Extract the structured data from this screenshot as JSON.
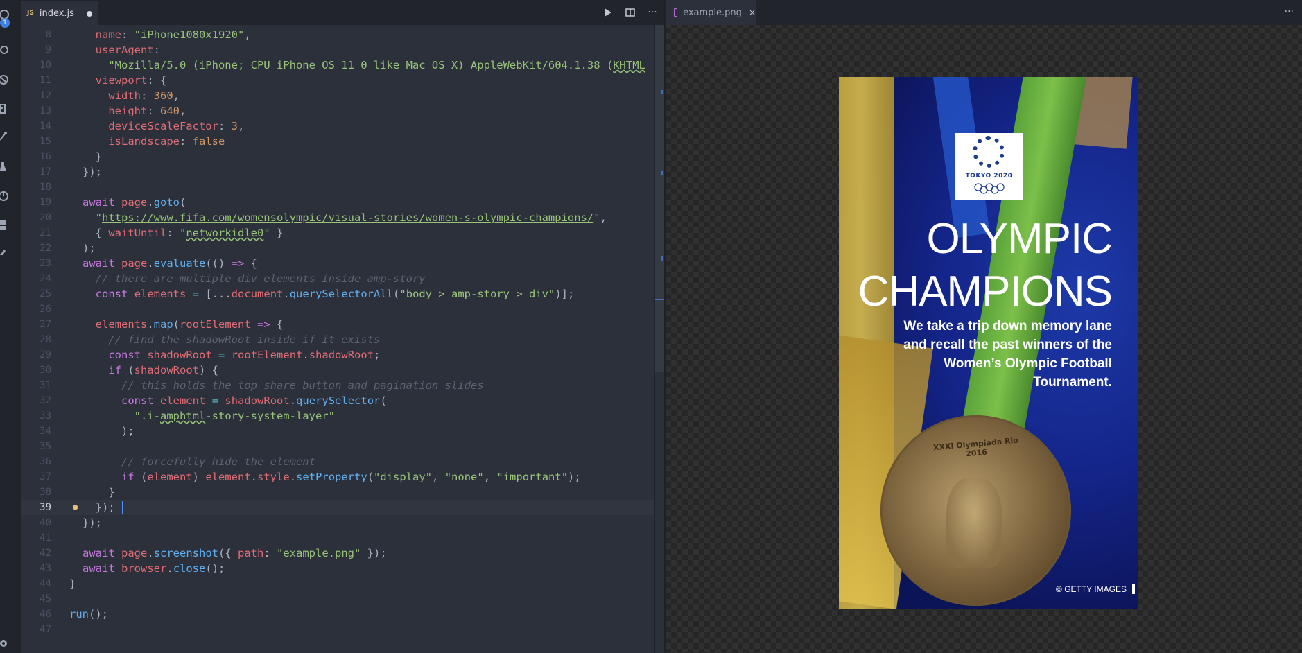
{
  "activity": {
    "badge": "1"
  },
  "editor": {
    "tab": {
      "label": "index.js",
      "icon": "JS"
    },
    "toolbar": {
      "run": "▶",
      "split": "split-editor",
      "more": "···"
    },
    "lines": [
      {
        "n": "8",
        "html": "  <span class=\"v\">name</span>: <span class=\"s\">\"iPhone1080x1920\"</span>,"
      },
      {
        "n": "9",
        "html": "  <span class=\"v\">userAgent</span>:"
      },
      {
        "n": "10",
        "html": "    <span class=\"s\">\"Mozilla/5.0 (iPhone; CPU iPhone OS 11_0 like Mac OS X) AppleWebKit/604.1.38 (<span class=\"w\">KHTML</span></span>"
      },
      {
        "n": "11",
        "html": "  <span class=\"v\">viewport</span>: {"
      },
      {
        "n": "12",
        "html": "    <span class=\"v\">width</span>: <span class=\"n\">360</span>,"
      },
      {
        "n": "13",
        "html": "    <span class=\"v\">height</span>: <span class=\"n\">640</span>,"
      },
      {
        "n": "14",
        "html": "    <span class=\"v\">deviceScaleFactor</span>: <span class=\"n\">3</span>,"
      },
      {
        "n": "15",
        "html": "    <span class=\"v\">isLandscape</span>: <span class=\"n\">false</span>"
      },
      {
        "n": "16",
        "html": "  }"
      },
      {
        "n": "17",
        "html": "});"
      },
      {
        "n": "18",
        "html": ""
      },
      {
        "n": "19",
        "html": "<span class=\"k\">await</span> <span class=\"v\">page</span>.<span class=\"f\">goto</span>("
      },
      {
        "n": "20",
        "html": "  <span class=\"s\">\"<span class=\"u\">https://www.fifa.com/womensolympic/visual-stories/women-s-olympic-champions/</span>\"</span>,"
      },
      {
        "n": "21",
        "html": "  { <span class=\"v\">waitUntil</span>: <span class=\"s\">\"<span class=\"w\">networkidle0</span>\"</span> }"
      },
      {
        "n": "22",
        "html": ");"
      },
      {
        "n": "23",
        "html": "<span class=\"k\">await</span> <span class=\"v\">page</span>.<span class=\"f\">evaluate</span>(() <span class=\"k\">=&gt;</span> {"
      },
      {
        "n": "24",
        "html": "  <span class=\"c\">// there are multiple div elements inside amp-story</span>"
      },
      {
        "n": "25",
        "html": "  <span class=\"k\">const</span> <span class=\"v\">elements</span> <span class=\"o\">=</span> [...<span class=\"v\">document</span>.<span class=\"f\">querySelectorAll</span>(<span class=\"s\">\"body &gt; amp-story &gt; div\"</span>)];"
      },
      {
        "n": "26",
        "html": ""
      },
      {
        "n": "27",
        "html": "  <span class=\"v\">elements</span>.<span class=\"f\">map</span>(<span class=\"v\">rootElement</span> <span class=\"k\">=&gt;</span> {"
      },
      {
        "n": "28",
        "html": "    <span class=\"c\">// find the shadowRoot inside if it exists</span>"
      },
      {
        "n": "29",
        "html": "    <span class=\"k\">const</span> <span class=\"v\">shadowRoot</span> <span class=\"o\">=</span> <span class=\"v\">rootElement</span>.<span class=\"v\">shadowRoot</span>;"
      },
      {
        "n": "30",
        "html": "    <span class=\"k\">if</span> (<span class=\"v\">shadowRoot</span>) {"
      },
      {
        "n": "31",
        "html": "      <span class=\"c\">// this holds the top share button and pagination slides</span>"
      },
      {
        "n": "32",
        "html": "      <span class=\"k\">const</span> <span class=\"v\">element</span> <span class=\"o\">=</span> <span class=\"v\">shadowRoot</span>.<span class=\"f\">querySelector</span>("
      },
      {
        "n": "33",
        "html": "        <span class=\"s\">\".i-<span class=\"w\">amphtml</span>-story-system-layer\"</span>"
      },
      {
        "n": "34",
        "html": "      );"
      },
      {
        "n": "35",
        "html": ""
      },
      {
        "n": "36",
        "html": "      <span class=\"c\">// forcefully hide the element</span>"
      },
      {
        "n": "37",
        "html": "      <span class=\"k\">if</span> (<span class=\"v\">element</span>) <span class=\"v\">element</span>.<span class=\"v\">style</span>.<span class=\"f\">setProperty</span>(<span class=\"s\">\"display\"</span>, <span class=\"s\">\"none\"</span>, <span class=\"s\">\"important\"</span>);"
      },
      {
        "n": "38",
        "html": "    }"
      },
      {
        "n": "39",
        "html": "  });",
        "current": true
      },
      {
        "n": "40",
        "html": "});"
      },
      {
        "n": "41",
        "html": ""
      },
      {
        "n": "42",
        "html": "<span class=\"k\">await</span> <span class=\"v\">page</span>.<span class=\"f\">screenshot</span>({ <span class=\"v\">path</span>: <span class=\"s\">\"example.png\"</span> });"
      },
      {
        "n": "43",
        "html": "<span class=\"k\">await</span> <span class=\"v\">browser</span>.<span class=\"f\">close</span>();"
      },
      {
        "n": "44",
        "html": "}",
        "indent": -1
      },
      {
        "n": "45",
        "html": ""
      },
      {
        "n": "46",
        "html": "<span class=\"f\">run</span>();",
        "indent": -1
      },
      {
        "n": "47",
        "html": ""
      }
    ]
  },
  "preview": {
    "tab": {
      "label": "example.png",
      "close": "×"
    },
    "more": "···",
    "story": {
      "logo_text": "TOKYO 2020",
      "title_line1": "OLYMPIC",
      "title_line2": "CHAMPIONS",
      "subtitle": "We take a trip down memory lane and recall the past winners of the Women’s Olympic Football Tournament.",
      "medal_text": "XXXI Olympiada Rio 2016",
      "credit": "© GETTY IMAGES"
    }
  },
  "colors": {
    "editor_bg": "#2b303b",
    "keyword": "#c678dd",
    "string": "#98c379",
    "function": "#61afef",
    "number": "#d19a66",
    "variable": "#e06c75"
  }
}
